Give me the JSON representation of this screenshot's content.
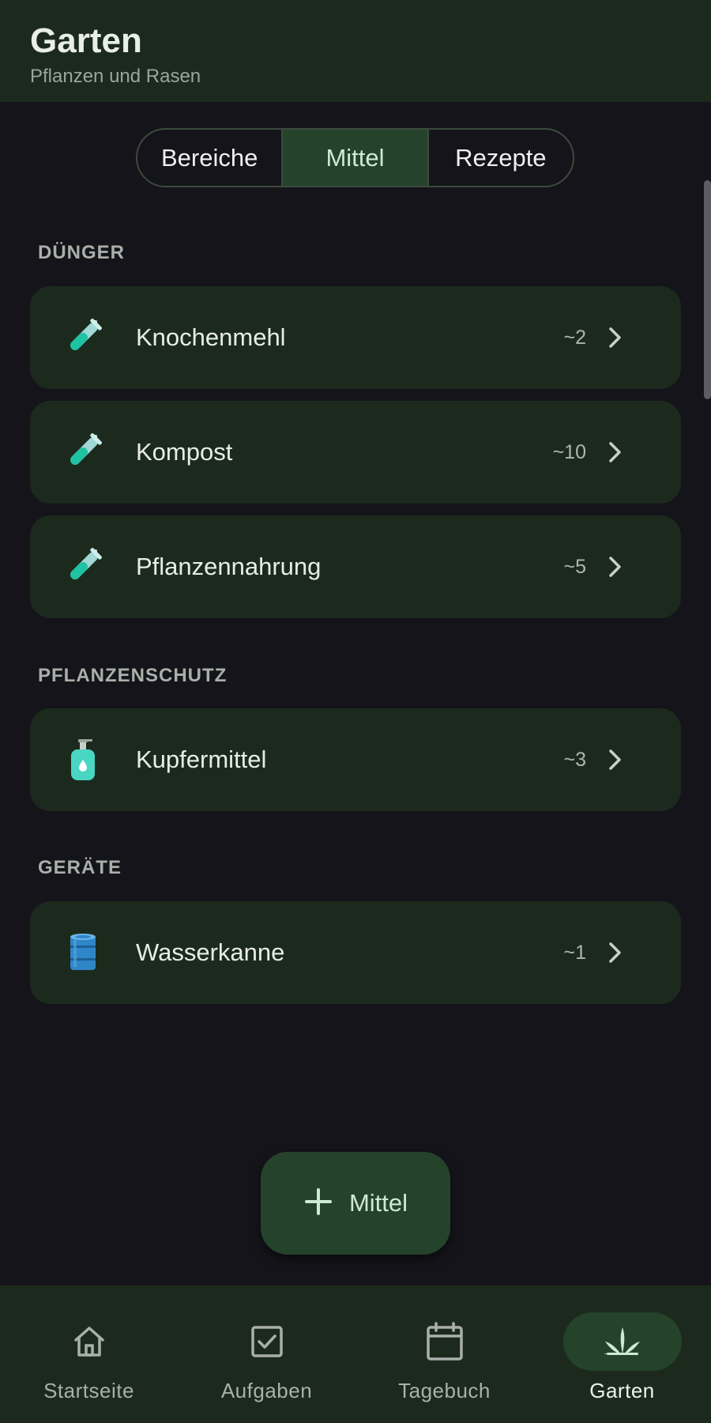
{
  "header": {
    "title": "Garten",
    "subtitle": "Pflanzen und Rasen"
  },
  "segmented": {
    "tabs": [
      {
        "label": "Bereiche",
        "active": false
      },
      {
        "label": "Mittel",
        "active": true
      },
      {
        "label": "Rezepte",
        "active": false
      }
    ]
  },
  "sections": [
    {
      "label": "DÜNGER",
      "items": [
        {
          "name": "Knochenmehl",
          "count": "~2",
          "icon": "test-tube-icon"
        },
        {
          "name": "Kompost",
          "count": "~10",
          "icon": "test-tube-icon"
        },
        {
          "name": "Pflanzennahrung",
          "count": "~5",
          "icon": "test-tube-icon"
        }
      ]
    },
    {
      "label": "PFLANZENSCHUTZ",
      "items": [
        {
          "name": "Kupfermittel",
          "count": "~3",
          "icon": "lotion-bottle-icon"
        }
      ]
    },
    {
      "label": "GERÄTE",
      "items": [
        {
          "name": "Wasserkanne",
          "count": "~1",
          "icon": "oil-drum-icon"
        }
      ]
    }
  ],
  "fab": {
    "label": "Mittel",
    "icon": "plus-icon"
  },
  "bottom_nav": {
    "items": [
      {
        "label": "Startseite",
        "icon": "home-icon",
        "active": false
      },
      {
        "label": "Aufgaben",
        "icon": "checkbox-icon",
        "active": false
      },
      {
        "label": "Tagebuch",
        "icon": "calendar-icon",
        "active": false
      },
      {
        "label": "Garten",
        "icon": "plant-icon",
        "active": true
      }
    ]
  },
  "colors": {
    "background": "#15141a",
    "surface": "#1c2a1e",
    "accent": "#25432b",
    "accent_text": "#cfe9d2"
  }
}
